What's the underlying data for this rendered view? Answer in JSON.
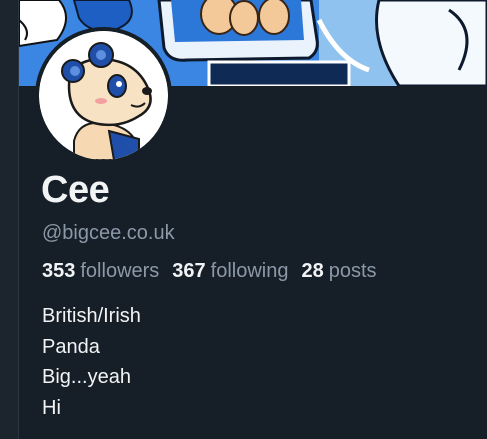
{
  "profile": {
    "display_name": "Cee",
    "handle": "@bigcee.co.uk",
    "stats": {
      "followers_count": "353",
      "followers_label": "followers",
      "following_count": "367",
      "following_label": "following",
      "posts_count": "28",
      "posts_label": "posts"
    },
    "bio_lines": [
      "British/Irish",
      "Panda",
      "Big...yeah",
      "Hi"
    ]
  },
  "icons": {
    "avatar": "panda-avatar",
    "banner": "cartoon-banner-image"
  },
  "colors": {
    "background": "#161e27",
    "text_primary": "#f1f3f5",
    "text_secondary": "#8b98a8",
    "banner_blue": "#3c8ae6"
  }
}
